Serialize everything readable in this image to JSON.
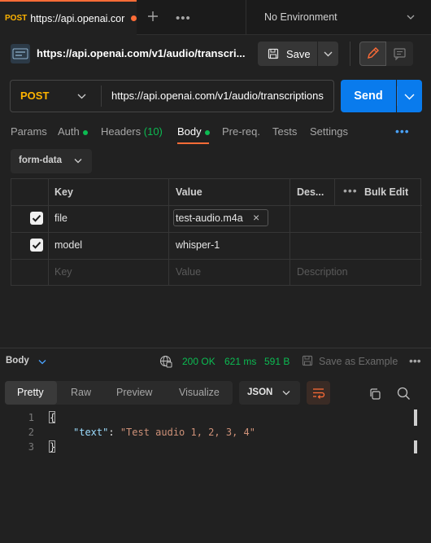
{
  "tab": {
    "method": "POST",
    "title": "https://api.openai.cor",
    "unsaved": true
  },
  "environment": {
    "selected": "No Environment"
  },
  "request": {
    "name": "https://api.openai.com/v1/audio/transcri...",
    "method": "POST",
    "url": "https://api.openai.com/v1/audio/transcriptions",
    "save_label": "Save",
    "send_label": "Send"
  },
  "request_tabs": {
    "params": "Params",
    "auth": "Auth",
    "headers": "Headers",
    "headers_count": "(10)",
    "body": "Body",
    "prereq": "Pre-req.",
    "tests": "Tests",
    "settings": "Settings",
    "active": "Body"
  },
  "body_type": {
    "selected": "form-data"
  },
  "params_table": {
    "headers": {
      "key": "Key",
      "value": "Value",
      "description": "Des...",
      "bulk_edit": "Bulk Edit"
    },
    "rows": [
      {
        "checked": true,
        "key": "file",
        "value": "test-audio.m4a",
        "value_type": "file",
        "description": ""
      },
      {
        "checked": true,
        "key": "model",
        "value": "whisper-1",
        "value_type": "text",
        "description": ""
      }
    ],
    "placeholders": {
      "key": "Key",
      "value": "Value",
      "description": "Description"
    }
  },
  "response": {
    "section_label": "Body",
    "status": "200 OK",
    "time": "621 ms",
    "size": "591 B",
    "save_example": "Save as Example",
    "view_tabs": {
      "pretty": "Pretty",
      "raw": "Raw",
      "preview": "Preview",
      "visualize": "Visualize",
      "active": "Pretty"
    },
    "format": "JSON",
    "lines": [
      {
        "number": "1",
        "text": "{"
      },
      {
        "number": "2",
        "key": "\"text\"",
        "colon": ": ",
        "value": "\"Test audio 1, 2, 3, 4\""
      },
      {
        "number": "3",
        "text": "}"
      }
    ]
  },
  "colors": {
    "accent": "#ff6c37",
    "send_blue": "#097bed",
    "method_post": "#ffb400",
    "success_green": "#0cbb52",
    "json_key": "#9cdcfe",
    "json_string": "#ce9178"
  }
}
